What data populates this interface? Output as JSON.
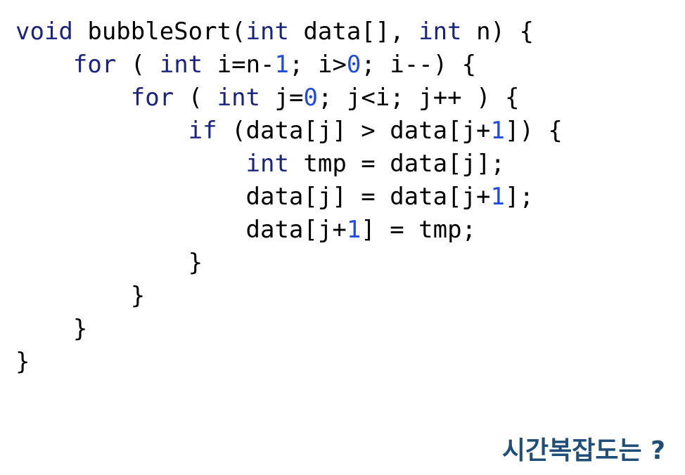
{
  "colors": {
    "keyword": "#1a237e",
    "number": "#1e4be0",
    "text": "#000000",
    "question": "#1f4e79"
  },
  "code": {
    "lines": [
      [
        {
          "t": "void",
          "c": "kw"
        },
        {
          "t": " bubbleSort(",
          "c": "tx"
        },
        {
          "t": "int",
          "c": "kw"
        },
        {
          "t": " data[], ",
          "c": "tx"
        },
        {
          "t": "int",
          "c": "kw"
        },
        {
          "t": " n) {",
          "c": "tx"
        }
      ],
      [
        {
          "t": "    ",
          "c": "tx"
        },
        {
          "t": "for",
          "c": "kw"
        },
        {
          "t": " ( ",
          "c": "tx"
        },
        {
          "t": "int",
          "c": "kw"
        },
        {
          "t": " i=n-",
          "c": "tx"
        },
        {
          "t": "1",
          "c": "num"
        },
        {
          "t": "; i>",
          "c": "tx"
        },
        {
          "t": "0",
          "c": "num"
        },
        {
          "t": "; i--) {",
          "c": "tx"
        }
      ],
      [
        {
          "t": "        ",
          "c": "tx"
        },
        {
          "t": "for",
          "c": "kw"
        },
        {
          "t": " ( ",
          "c": "tx"
        },
        {
          "t": "int",
          "c": "kw"
        },
        {
          "t": " j=",
          "c": "tx"
        },
        {
          "t": "0",
          "c": "num"
        },
        {
          "t": "; j<i; j++ ) {",
          "c": "tx"
        }
      ],
      [
        {
          "t": "            ",
          "c": "tx"
        },
        {
          "t": "if",
          "c": "kw"
        },
        {
          "t": " (data[j] > data[j+",
          "c": "tx"
        },
        {
          "t": "1",
          "c": "num"
        },
        {
          "t": "]) {",
          "c": "tx"
        }
      ],
      [
        {
          "t": "                ",
          "c": "tx"
        },
        {
          "t": "int",
          "c": "kw"
        },
        {
          "t": " tmp = data[j];",
          "c": "tx"
        }
      ],
      [
        {
          "t": "                data[j] = data[j+",
          "c": "tx"
        },
        {
          "t": "1",
          "c": "num"
        },
        {
          "t": "];",
          "c": "tx"
        }
      ],
      [
        {
          "t": "                data[j+",
          "c": "tx"
        },
        {
          "t": "1",
          "c": "num"
        },
        {
          "t": "] = tmp;",
          "c": "tx"
        }
      ],
      [
        {
          "t": "            }",
          "c": "tx"
        }
      ],
      [
        {
          "t": "        }",
          "c": "tx"
        }
      ],
      [
        {
          "t": "    }",
          "c": "tx"
        }
      ],
      [
        {
          "t": "}",
          "c": "tx"
        }
      ]
    ]
  },
  "question": {
    "text": "시간복잡도는 ?"
  }
}
